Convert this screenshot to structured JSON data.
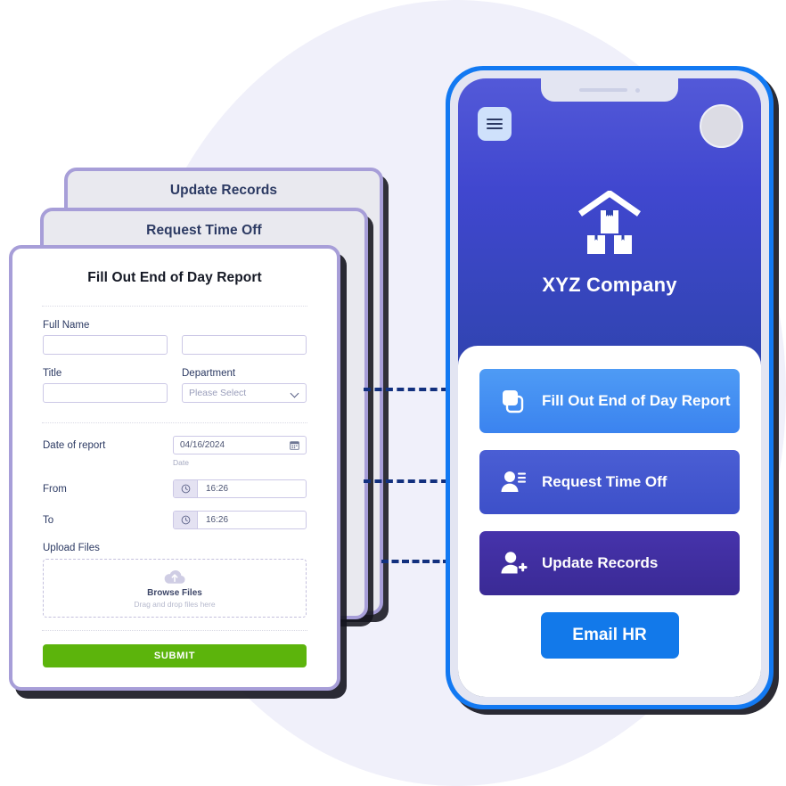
{
  "background": {
    "circle_color": "#f0f0fa"
  },
  "card_stack": {
    "back_card": {
      "title": "Update Records"
    },
    "mid_card": {
      "title": "Request Time Off"
    },
    "front_card": {
      "title": "Fill Out End of Day Report",
      "fields": {
        "full_name_label": "Full Name",
        "full_name_value": "",
        "full_name_second_value": "",
        "title_label": "Title",
        "title_value": "",
        "department_label": "Department",
        "department_placeholder": "Please Select",
        "date_label": "Date of report",
        "date_value": "04/16/2024",
        "date_hint": "Date",
        "from_label": "From",
        "from_value": "16:26",
        "to_label": "To",
        "to_value": "16:26",
        "upload_label": "Upload Files",
        "upload_browse": "Browse Files",
        "upload_hint": "Drag and drop files here"
      },
      "submit_label": "SUBMIT",
      "submit_color": "#5cb40c",
      "border_color": "#a79ed8"
    }
  },
  "connectors": {
    "color": "#12307e",
    "items": [
      {
        "target": "Fill Out End of Day Report"
      },
      {
        "target": "Request Time Off"
      },
      {
        "target": "Update Records"
      }
    ]
  },
  "phone": {
    "frame_color": "#1279f2",
    "header": {
      "menu_icon": "hamburger-icon",
      "avatar_icon": "avatar-placeholder",
      "logo_icon": "warehouse-boxes-icon",
      "company_name": "XYZ Company"
    },
    "actions": [
      {
        "label": "Fill Out End of Day Report",
        "icon": "copy-squares-icon",
        "color": "#3b83ef"
      },
      {
        "label": "Request Time Off",
        "icon": "user-list-icon",
        "color": "#3d50c9"
      },
      {
        "label": "Update Records",
        "icon": "user-plus-icon",
        "color": "#3a2a95"
      }
    ],
    "email_button": {
      "label": "Email HR",
      "color": "#1279ea"
    }
  }
}
